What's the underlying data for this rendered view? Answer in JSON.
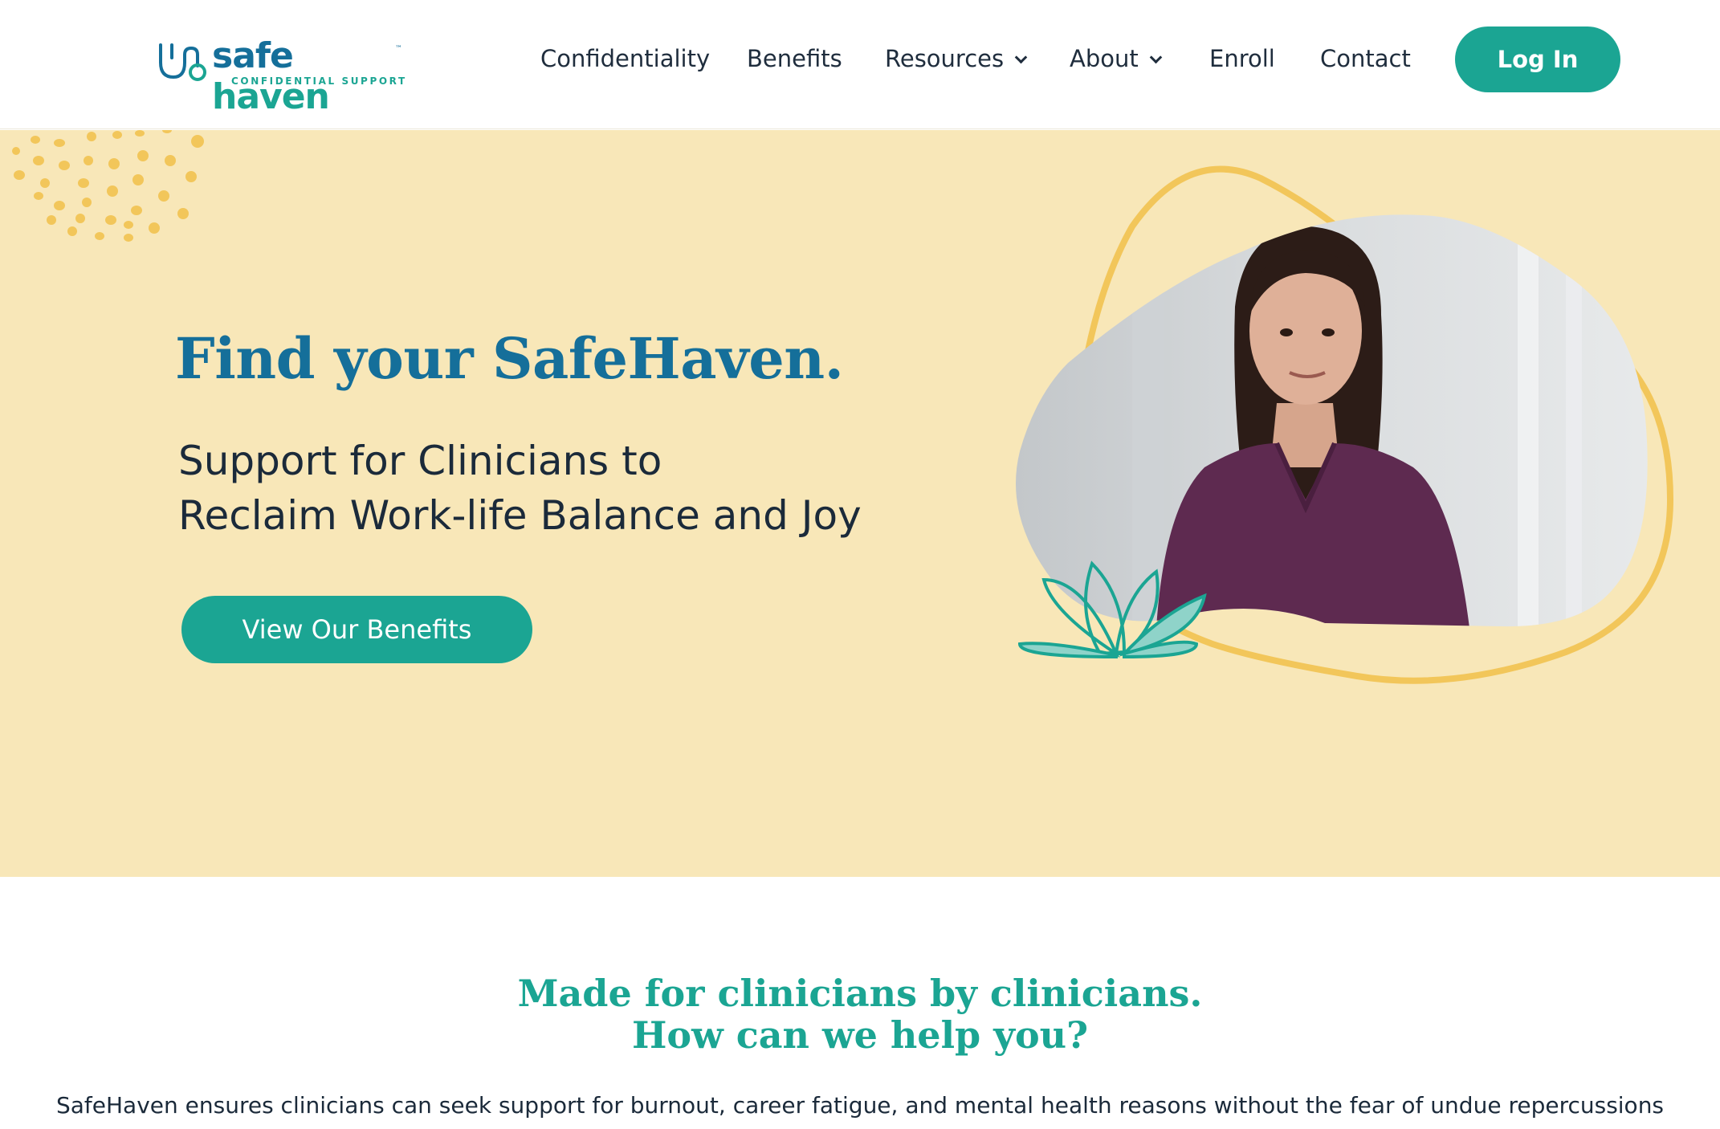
{
  "brand": {
    "word1": "safe",
    "word2": "haven",
    "trademark": "™",
    "tagline": "CONFIDENTIAL SUPPORT",
    "icon": "stethoscope-icon"
  },
  "nav": {
    "items": [
      {
        "label": "Confidentiality"
      },
      {
        "label": "Benefits"
      },
      {
        "label": "Resources",
        "icon": "chevron-down-icon"
      },
      {
        "label": "About",
        "icon": "chevron-down-icon"
      },
      {
        "label": "Enroll"
      },
      {
        "label": "Contact"
      }
    ],
    "login_label": "Log In"
  },
  "hero": {
    "title": "Find your SafeHaven.",
    "subtitle_line1": "Support for Clinicians to",
    "subtitle_line2": "Reclaim Work-life Balance and Joy",
    "cta_label": "View Our Benefits",
    "photo": "portrait of clinician in purple scrubs"
  },
  "section": {
    "line1": "Made for clinicians by clinicians.",
    "line2": "How can we help you?",
    "body": "SafeHaven ensures clinicians can seek support for burnout, career fatigue, and mental health reasons without the fear of undue repercussions"
  },
  "colors": {
    "primary_blue": "#156f9a",
    "teal": "#1ba593",
    "hero_bg": "#f8e7b8",
    "accent_yellow": "#f2c65a",
    "scrub_purple": "#5e2a50"
  }
}
